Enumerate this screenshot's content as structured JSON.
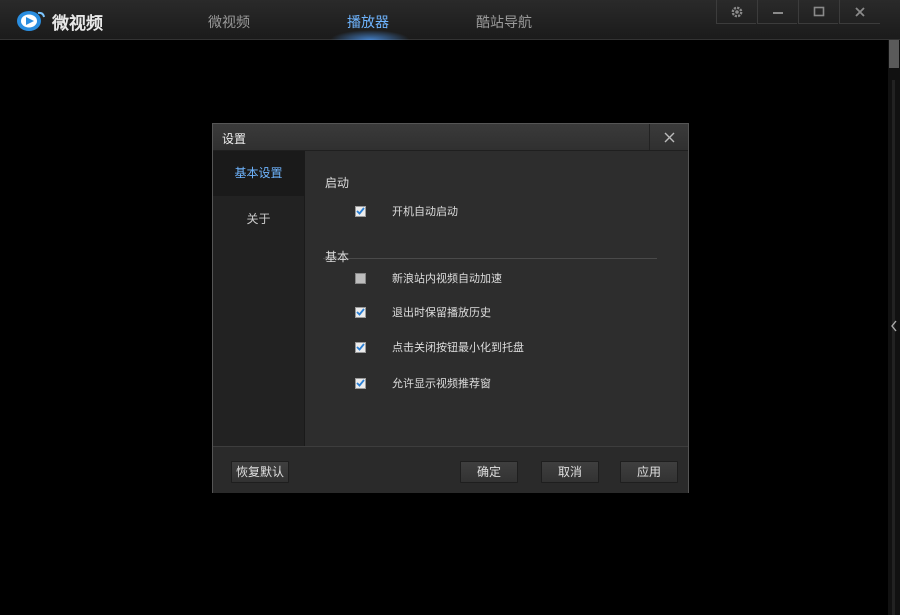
{
  "app": {
    "name": "微视频",
    "tabs": [
      {
        "label": "微视频",
        "active": false
      },
      {
        "label": "播放器",
        "active": true
      },
      {
        "label": "酷站导航",
        "active": false
      }
    ],
    "window_buttons": {
      "settings_icon": "gear-icon",
      "minimize_icon": "minimize-icon",
      "maximize_icon": "maximize-icon",
      "close_icon": "close-icon"
    }
  },
  "dialog": {
    "title": "设置",
    "sidebar": [
      {
        "label": "基本设置",
        "active": true
      },
      {
        "label": "关于",
        "active": false
      }
    ],
    "sections": {
      "startup": {
        "title": "启动",
        "options": [
          {
            "label": "开机自动启动",
            "checked": true
          }
        ]
      },
      "basic": {
        "title": "基本",
        "options": [
          {
            "label": "新浪站内视频自动加速",
            "checked": false
          },
          {
            "label": "退出时保留播放历史",
            "checked": true
          },
          {
            "label": "点击关闭按钮最小化到托盘",
            "checked": true
          },
          {
            "label": "允许显示视频推荐窗",
            "checked": true
          }
        ]
      }
    },
    "buttons": {
      "restore_default": "恢复默认",
      "ok": "确定",
      "cancel": "取消",
      "apply": "应用"
    }
  },
  "colors": {
    "accent": "#6fb5ff",
    "check": "#2a7fd4",
    "background": "#000000",
    "dialog_bg": "#2d2d2d"
  }
}
